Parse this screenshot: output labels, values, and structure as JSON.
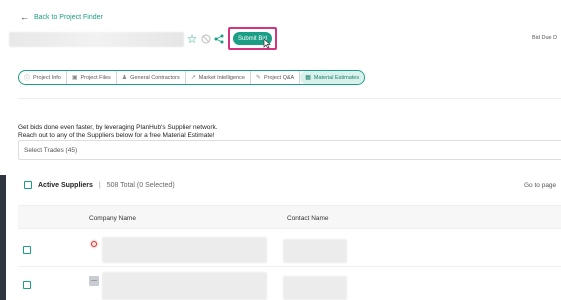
{
  "header": {
    "back_label": "Back to Project Finder",
    "submit_label": "Submit Bid",
    "bid_due_label": "Bid Due D"
  },
  "tabs": [
    {
      "label": "Project Info",
      "icon": "info-icon"
    },
    {
      "label": "Project Files",
      "icon": "file-icon"
    },
    {
      "label": "General Contractors",
      "icon": "person-icon"
    },
    {
      "label": "Market Intelligence",
      "icon": "chart-icon"
    },
    {
      "label": "Project Q&A",
      "icon": "chat-icon"
    },
    {
      "label": "Material Estimates",
      "icon": "estimate-icon",
      "active": true
    }
  ],
  "intro": {
    "line1": "Get bids done even faster, by leveraging PlanHub's Supplier network.",
    "line2": "Reach out to any of the Suppliers below for a free Material Estimate!"
  },
  "trades_select": {
    "value": "Select Trades (45)"
  },
  "suppliers": {
    "title": "Active Suppliers",
    "total": "508 Total (0 Selected)",
    "goto_label": "Go to page"
  },
  "table": {
    "columns": [
      "Company Name",
      "Contact Name"
    ]
  },
  "colors": {
    "accent": "#1a9e86",
    "highlight": "#d4347d"
  }
}
